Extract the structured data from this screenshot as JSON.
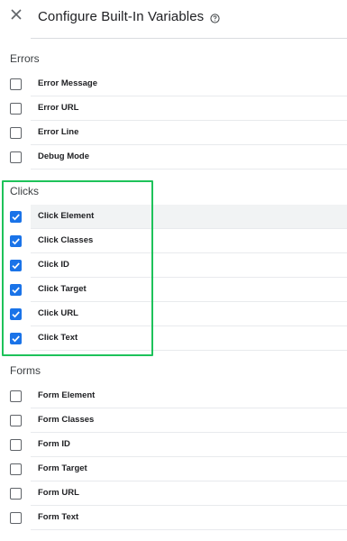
{
  "dialog": {
    "title": "Configure Built-In Variables",
    "close_icon": "close-icon",
    "help_icon": "help-icon"
  },
  "colors": {
    "checkbox_checked": "#1a73e8",
    "highlight_box": "#1ec25a",
    "row_hover": "#f1f3f4"
  },
  "sections": [
    {
      "title": "Errors",
      "items": [
        {
          "label": "Error Message",
          "checked": false
        },
        {
          "label": "Error URL",
          "checked": false
        },
        {
          "label": "Error Line",
          "checked": false
        },
        {
          "label": "Debug Mode",
          "checked": false
        }
      ]
    },
    {
      "title": "Clicks",
      "items": [
        {
          "label": "Click Element",
          "checked": true
        },
        {
          "label": "Click Classes",
          "checked": true
        },
        {
          "label": "Click ID",
          "checked": true
        },
        {
          "label": "Click Target",
          "checked": true
        },
        {
          "label": "Click URL",
          "checked": true
        },
        {
          "label": "Click Text",
          "checked": true
        }
      ]
    },
    {
      "title": "Forms",
      "items": [
        {
          "label": "Form Element",
          "checked": false
        },
        {
          "label": "Form Classes",
          "checked": false
        },
        {
          "label": "Form ID",
          "checked": false
        },
        {
          "label": "Form Target",
          "checked": false
        },
        {
          "label": "Form URL",
          "checked": false
        },
        {
          "label": "Form Text",
          "checked": false
        }
      ]
    }
  ]
}
